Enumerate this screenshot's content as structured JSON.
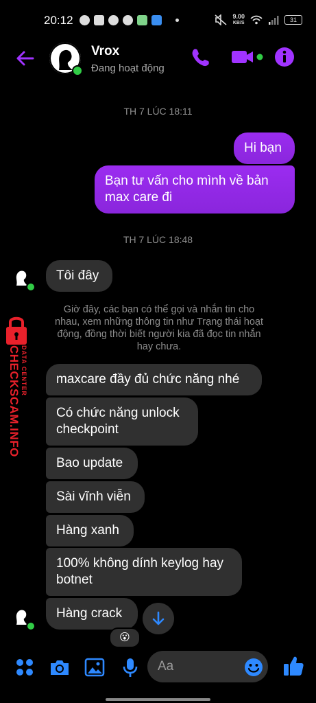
{
  "status_bar": {
    "time": "20:12",
    "net_speed_value": "9.00",
    "net_speed_unit": "KB/S",
    "battery": "31"
  },
  "header": {
    "contact_name": "Vrox",
    "status": "Đang hoạt động",
    "accent_color": "#a033ff",
    "online_color": "#31cc46"
  },
  "messages": {
    "ts1": "TH 7 LÚC 18:11",
    "out1": "Hi bạn",
    "out2": "Bạn tư vấn cho mình về bản max care đi",
    "ts2": "TH 7 LÚC 18:48",
    "in1": "Tôi đây",
    "notice": "Giờ đây, các bạn có thể gọi và nhắn tin cho nhau, xem những thông tin như Trạng thái hoạt động, đồng thời biết người kia đã đọc tin nhắn hay chưa.",
    "in2": "maxcare đầy đủ chức năng nhé",
    "in3": "Có chức năng unlock checkpoint",
    "in4": "Bao update",
    "in5": "Sài vĩnh viễn",
    "in6": "Hàng xanh",
    "in7": "100% không dính keylog hay botnet",
    "in8": "Hàng crack",
    "reaction": "😮"
  },
  "watermark": {
    "line1": "DATA CENTER",
    "line2": "CHECKSCAM.INFO"
  },
  "composer": {
    "placeholder": "Aa"
  },
  "icons": [
    "back-arrow-icon",
    "phone-icon",
    "video-icon",
    "info-icon",
    "apps-icon",
    "camera-icon",
    "gallery-icon",
    "mic-icon",
    "emoji-icon",
    "like-icon",
    "arrow-down-icon"
  ]
}
